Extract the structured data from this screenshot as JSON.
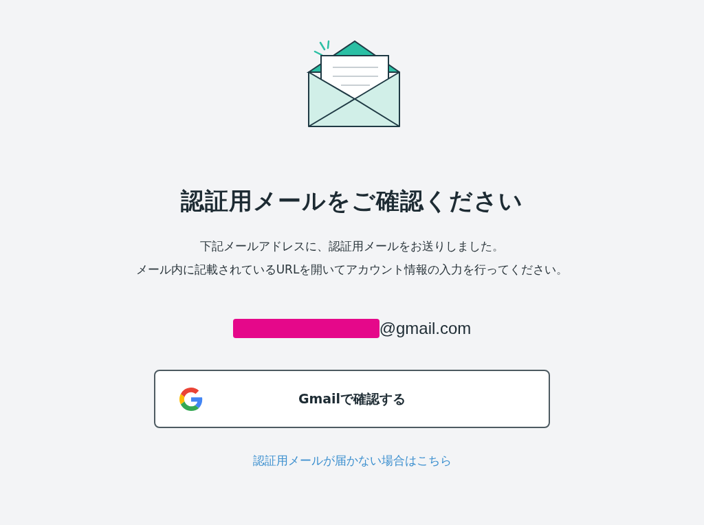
{
  "title": "認証用メールをご確認ください",
  "message": [
    "下記メールアドレスに、認証用メールをお送りしました。",
    "メール内に記載されているURLを開いてアカウント情報の入力を行ってください。"
  ],
  "email": {
    "redacted": true,
    "domain": "@gmail.com"
  },
  "gmail_button": {
    "label": "Gmailで確認する"
  },
  "help_link": "認証用メールが届かない場合はこちら"
}
